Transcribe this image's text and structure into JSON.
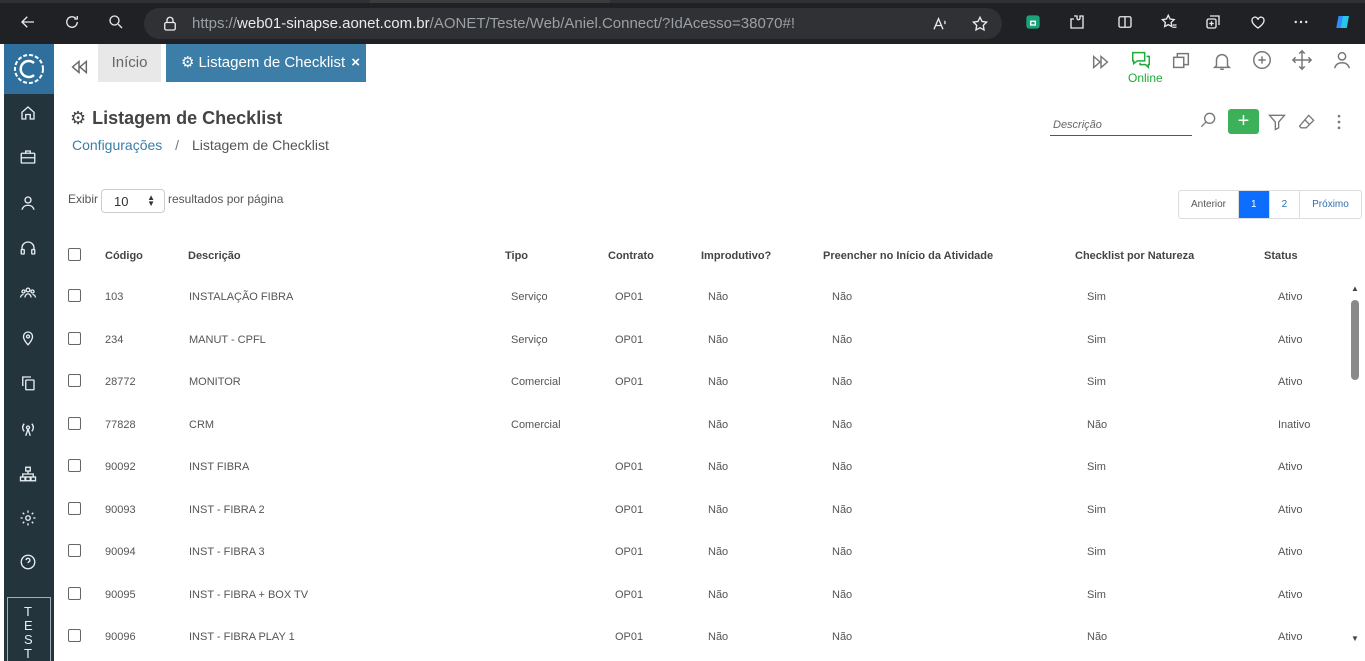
{
  "browser": {
    "url_prefix": "https://",
    "url_host": "web01-sinapse.aonet.com.br",
    "url_path": "/AONET/Teste/Web/Aniel.Connect/?IdAcesso=38070#!"
  },
  "rail": {
    "items": [
      "home-icon",
      "briefcase-icon",
      "user-icon",
      "headset-icon",
      "team-icon",
      "map-pin-icon",
      "copy-icon",
      "antenna-icon",
      "hierarchy-icon",
      "gear-icon",
      "help-icon"
    ],
    "env_label": "TEST"
  },
  "tabs": {
    "home": "Início",
    "active": "Listagem de Checklist",
    "close": "×"
  },
  "status": {
    "online": "Online"
  },
  "header": {
    "title": "Listagem de Checklist",
    "breadcrumb_parent": "Configurações",
    "breadcrumb_sep": "/",
    "breadcrumb_current": "Listagem de Checklist",
    "search_placeholder": "Descrição",
    "add_label": "+"
  },
  "length": {
    "prefix": "Exibir",
    "value": "10",
    "suffix": "resultados por página"
  },
  "pagination": {
    "prev": "Anterior",
    "pages": [
      "1",
      "2"
    ],
    "current": "1",
    "next": "Próximo"
  },
  "table": {
    "headers": [
      "Código",
      "Descrição",
      "Tipo",
      "Contrato",
      "Improdutivo?",
      "Preencher no Início da Atividade",
      "Checklist por Natureza",
      "Status"
    ],
    "rows": [
      [
        "103",
        "INSTALAÇÃO FIBRA",
        "Serviço",
        "OP01",
        "Não",
        "Não",
        "Sim",
        "Ativo"
      ],
      [
        "234",
        "MANUT - CPFL",
        "Serviço",
        "OP01",
        "Não",
        "Não",
        "Sim",
        "Ativo"
      ],
      [
        "28772",
        "MONITOR",
        "Comercial",
        "OP01",
        "Não",
        "Não",
        "Sim",
        "Ativo"
      ],
      [
        "77828",
        "CRM",
        "Comercial",
        "",
        "Não",
        "Não",
        "Não",
        "Inativo"
      ],
      [
        "90092",
        "INST FIBRA",
        "",
        "OP01",
        "Não",
        "Não",
        "Sim",
        "Ativo"
      ],
      [
        "90093",
        "INST - FIBRA 2",
        "",
        "OP01",
        "Não",
        "Não",
        "Sim",
        "Ativo"
      ],
      [
        "90094",
        "INST - FIBRA 3",
        "",
        "OP01",
        "Não",
        "Não",
        "Sim",
        "Ativo"
      ],
      [
        "90095",
        "INST - FIBRA + BOX TV",
        "",
        "OP01",
        "Não",
        "Não",
        "Sim",
        "Ativo"
      ],
      [
        "90096",
        "INST - FIBRA PLAY 1",
        "",
        "OP01",
        "Não",
        "Não",
        "Não",
        "Ativo"
      ]
    ]
  },
  "colors": {
    "accent": "#3c7ea8",
    "rail": "#24343c",
    "add": "#3cb15a",
    "online": "#1eaa3a",
    "page_current": "#0d6efd"
  }
}
